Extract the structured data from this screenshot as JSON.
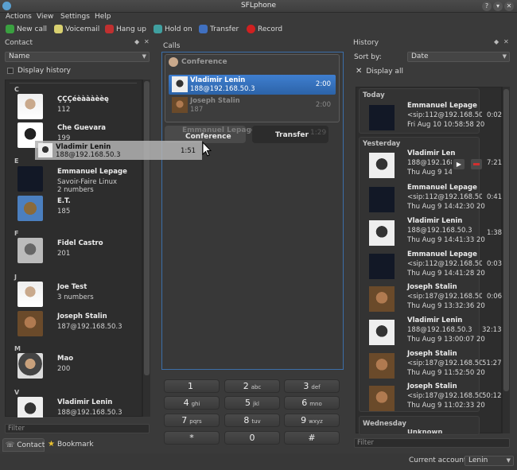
{
  "window": {
    "title": "SFLphone"
  },
  "menu": [
    "Actions",
    "View",
    "Settings",
    "Help"
  ],
  "toolbar": {
    "new_call": "New call",
    "voicemail": "Voicemail",
    "hang_up": "Hang up",
    "hold_on": "Hold on",
    "transfer": "Transfer",
    "record": "Record"
  },
  "contact_panel": {
    "title": "Contact",
    "sort_value": "Name",
    "display_history": "Display history",
    "filter_placeholder": "Filter",
    "groups": {
      "C": "C",
      "E": "E",
      "F": "F",
      "J": "J",
      "M": "M",
      "V": "V"
    },
    "contacts": [
      {
        "name": "ÇÇÇéèàààèèę",
        "sub": "112"
      },
      {
        "name": "Che Guevara",
        "sub": "199"
      },
      {
        "name": "Emmanuel Lepage",
        "sub": "Savoir-Faire Linux",
        "sub2": "2 numbers"
      },
      {
        "name": "E.T.",
        "sub": "185"
      },
      {
        "name": "Fidel Castro",
        "sub": "201"
      },
      {
        "name": "Joe Test",
        "sub": "3 numbers"
      },
      {
        "name": "Joseph Stalin",
        "sub": "187@192.168.50.3"
      },
      {
        "name": "Mao",
        "sub": "200"
      },
      {
        "name": "Vladimir Lenin",
        "sub": "188@192.168.50.3"
      }
    ],
    "tabs": {
      "contact": "Contact",
      "bookmark": "Bookmark"
    }
  },
  "drag_ghost": {
    "name": "Vladimir Lenin",
    "sub": "188@192.168.50.3",
    "time": "1:51"
  },
  "calls_panel": {
    "title": "Calls",
    "conference_label": "Conference",
    "conference_calls": [
      {
        "name": "Vladimir Lenin",
        "sub": "188@192.168.50.3",
        "time": "2:00"
      },
      {
        "name": "Joseph Stalin",
        "sub": "187",
        "time": "2:00"
      }
    ],
    "pending": {
      "name": "Emmanuel Lepage",
      "drop_conference": "Conference",
      "drop_transfer": "Transfer",
      "time": "1:29"
    },
    "keypad": [
      {
        "digit": "1",
        "letters": ""
      },
      {
        "digit": "2",
        "letters": "abc"
      },
      {
        "digit": "3",
        "letters": "def"
      },
      {
        "digit": "4",
        "letters": "ghi"
      },
      {
        "digit": "5",
        "letters": "jkl"
      },
      {
        "digit": "6",
        "letters": "mno"
      },
      {
        "digit": "7",
        "letters": "pqrs"
      },
      {
        "digit": "8",
        "letters": "tuv"
      },
      {
        "digit": "9",
        "letters": "wxyz"
      },
      {
        "digit": "*",
        "letters": ""
      },
      {
        "digit": "0",
        "letters": ""
      },
      {
        "digit": "#",
        "letters": ""
      }
    ]
  },
  "history_panel": {
    "title": "History",
    "sort_by_label": "Sort by:",
    "sort_value": "Date",
    "display_all": "Display all",
    "filter_placeholder": "Filter",
    "groups": {
      "today": "Today",
      "yesterday": "Yesterday",
      "wednesday": "Wednesday",
      "wed_next": "Unknown"
    },
    "items": [
      {
        "name": "Emmanuel Lepage",
        "sub": "<sip:112@192.168.50.3>",
        "date": "Fri Aug 10 10:58:58 2012",
        "dur": "0:02"
      },
      {
        "name": "Vladimir Len",
        "sub": "188@192.168",
        "date": "Thu Aug 9 14:",
        "dur": "7:21"
      },
      {
        "name": "Emmanuel Lepage",
        "sub": "<sip:112@192.168.50.3>",
        "date": "Thu Aug 9 14:42:30 2012",
        "dur": "0:41"
      },
      {
        "name": "Vladimir Lenin",
        "sub": "188@192.168.50.3",
        "date": "Thu Aug 9 14:41:33 2012",
        "dur": "1:38"
      },
      {
        "name": "Emmanuel Lepage",
        "sub": "<sip:112@192.168.50.3>",
        "date": "Thu Aug 9 14:41:28 2012",
        "dur": "0:03"
      },
      {
        "name": "Joseph Stalin",
        "sub": "<sip:187@192.168.50.3>",
        "date": "Thu Aug 9 13:32:36 2012",
        "dur": "0:06"
      },
      {
        "name": "Vladimir Lenin",
        "sub": "188@192.168.50.3",
        "date": "Thu Aug 9 13:00:07 201",
        "dur": "32:13"
      },
      {
        "name": "Joseph Stalin",
        "sub": "<sip:187@192.168.50.3>",
        "date": "Thu Aug 9 11:52:50 201",
        "dur": "51:27"
      },
      {
        "name": "Joseph Stalin",
        "sub": "<sip:187@192.168.50.3>",
        "date": "Thu Aug 9 11:02:33 201",
        "dur": "50:12"
      }
    ]
  },
  "status": {
    "account_label": "Current account:",
    "account_value": "Lenin"
  }
}
